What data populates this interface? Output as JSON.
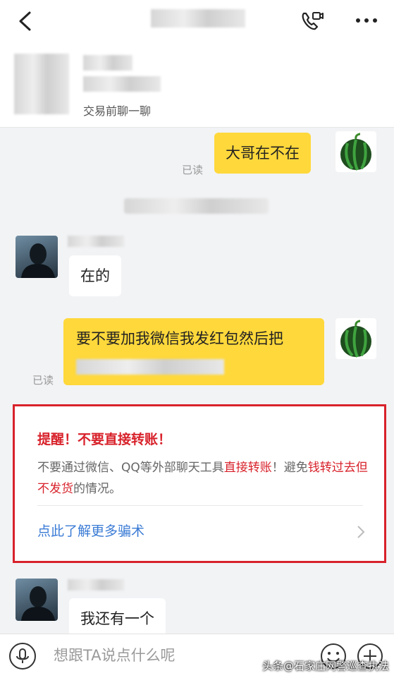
{
  "header": {
    "back_icon": "chevron-left-icon",
    "call_icon": "phone-video-icon",
    "more_icon": "more-dots-icon"
  },
  "product": {
    "subtitle": "交易前聊一聊"
  },
  "messages": {
    "m1": {
      "text": "大哥在不在",
      "status": "已读"
    },
    "m2": {
      "text": "在的"
    },
    "m3": {
      "text": "要不要加我微信我发红包然后把",
      "status": "已读"
    },
    "m4": {
      "text": "我还有一个"
    }
  },
  "warning": {
    "title": "提醒！不要直接转账！",
    "body_1": "不要通过微信、QQ等外部聊天工具",
    "body_hl1": "直接转账",
    "body_2": "！避免",
    "body_hl2": "钱转过去但不发货",
    "body_3": "的情况。",
    "link": "点此了解更多骗术",
    "accent": "#d8222b",
    "link_color": "#3a7bd5"
  },
  "input": {
    "placeholder": "想跟TA说点什么呢"
  },
  "watermark": "头条@石家庄网警巡查执法"
}
